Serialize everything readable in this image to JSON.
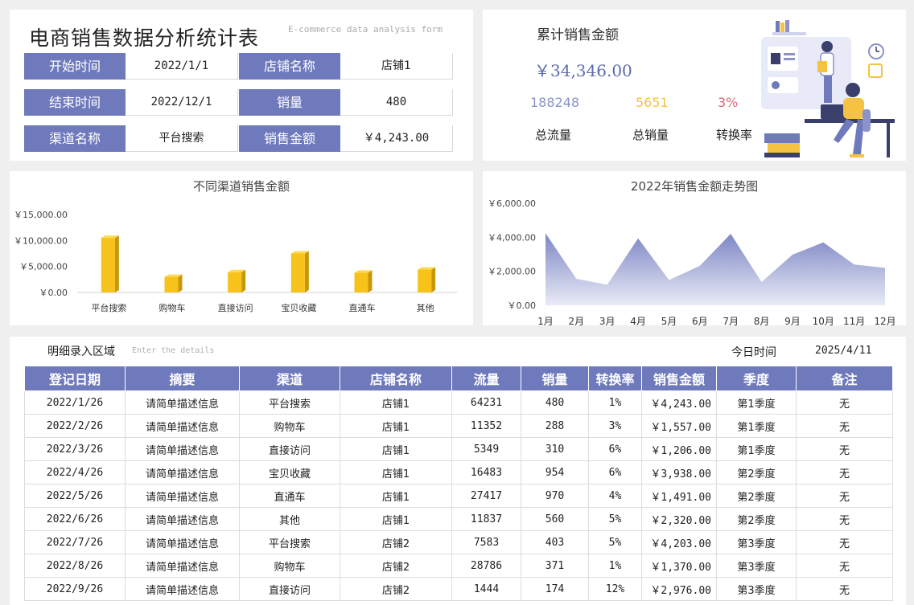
{
  "header": {
    "title": "电商销售数据分析统计表",
    "subtitle": "E-commerce data analysis form"
  },
  "info": {
    "start_label": "开始时间",
    "start_value": "2022/1/1",
    "shop_label": "店铺名称",
    "shop_value": "店铺1",
    "end_label": "结束时间",
    "end_value": "2022/12/1",
    "qty_label": "销量",
    "qty_value": "480",
    "channel_label": "渠道名称",
    "channel_value": "平台搜索",
    "amount_label": "销售金额",
    "amount_value": "￥4,243.00"
  },
  "kpi": {
    "title": "累计销售金额",
    "total": "￥34,346.00",
    "traffic_value": "188248",
    "traffic_label": "总流量",
    "sales_value": "5651",
    "sales_label": "总销量",
    "conv_value": "3%",
    "conv_label": "转换率",
    "colors": {
      "traffic": "#8b93c8",
      "sales": "#f5c242",
      "conv": "#e0647a"
    }
  },
  "colors": {
    "accent": "#6f7abd",
    "bar": "#f7c21a",
    "bar_side": "#c9980a",
    "area_top": "#7c86c4",
    "area_bottom": "#e9ebf6"
  },
  "chart_data": [
    {
      "type": "bar",
      "title": "不同渠道销售金额",
      "categories": [
        "平台搜索",
        "购物车",
        "直接访问",
        "宝贝收藏",
        "直通车",
        "其他"
      ],
      "values": [
        10500,
        3000,
        3900,
        7500,
        3800,
        4400
      ],
      "ylim": [
        0,
        15000
      ],
      "yticks": [
        0,
        5000,
        10000,
        15000
      ],
      "ytick_labels": [
        "￥0.00",
        "￥5,000.00",
        "￥10,000.00",
        "￥15,000.00"
      ]
    },
    {
      "type": "area",
      "title": "2022年销售金额走势图",
      "categories": [
        "1月",
        "2月",
        "3月",
        "4月",
        "5月",
        "6月",
        "7月",
        "8月",
        "9月",
        "10月",
        "11月",
        "12月"
      ],
      "values": [
        4243,
        1557,
        1206,
        3938,
        1491,
        2320,
        4203,
        1370,
        2976,
        3700,
        2400,
        2200
      ],
      "ylim": [
        0,
        6000
      ],
      "yticks": [
        0,
        2000,
        4000,
        6000
      ],
      "ytick_labels": [
        "￥0.00",
        "￥2,000.00",
        "￥4,000.00",
        "￥6,000.00"
      ]
    }
  ],
  "details": {
    "title": "明细录入区域",
    "subtitle": "Enter the details",
    "today_label": "今日时间",
    "today_value": "2025/4/11",
    "columns": [
      "登记日期",
      "摘要",
      "渠道",
      "店铺名称",
      "流量",
      "销量",
      "转换率",
      "销售金额",
      "季度",
      "备注"
    ],
    "rows": [
      [
        "2022/1/26",
        "请简单描述信息",
        "平台搜索",
        "店铺1",
        "64231",
        "480",
        "1%",
        "￥4,243.00",
        "第1季度",
        "无"
      ],
      [
        "2022/2/26",
        "请简单描述信息",
        "购物车",
        "店铺1",
        "11352",
        "288",
        "3%",
        "￥1,557.00",
        "第1季度",
        "无"
      ],
      [
        "2022/3/26",
        "请简单描述信息",
        "直接访问",
        "店铺1",
        "5349",
        "310",
        "6%",
        "￥1,206.00",
        "第1季度",
        "无"
      ],
      [
        "2022/4/26",
        "请简单描述信息",
        "宝贝收藏",
        "店铺1",
        "16483",
        "954",
        "6%",
        "￥3,938.00",
        "第2季度",
        "无"
      ],
      [
        "2022/5/26",
        "请简单描述信息",
        "直通车",
        "店铺1",
        "27417",
        "970",
        "4%",
        "￥1,491.00",
        "第2季度",
        "无"
      ],
      [
        "2022/6/26",
        "请简单描述信息",
        "其他",
        "店铺1",
        "11837",
        "560",
        "5%",
        "￥2,320.00",
        "第2季度",
        "无"
      ],
      [
        "2022/7/26",
        "请简单描述信息",
        "平台搜索",
        "店铺2",
        "7583",
        "403",
        "5%",
        "￥4,203.00",
        "第3季度",
        "无"
      ],
      [
        "2022/8/26",
        "请简单描述信息",
        "购物车",
        "店铺2",
        "28786",
        "371",
        "1%",
        "￥1,370.00",
        "第3季度",
        "无"
      ],
      [
        "2022/9/26",
        "请简单描述信息",
        "直接访问",
        "店铺2",
        "1444",
        "174",
        "12%",
        "￥2,976.00",
        "第3季度",
        "无"
      ]
    ]
  }
}
